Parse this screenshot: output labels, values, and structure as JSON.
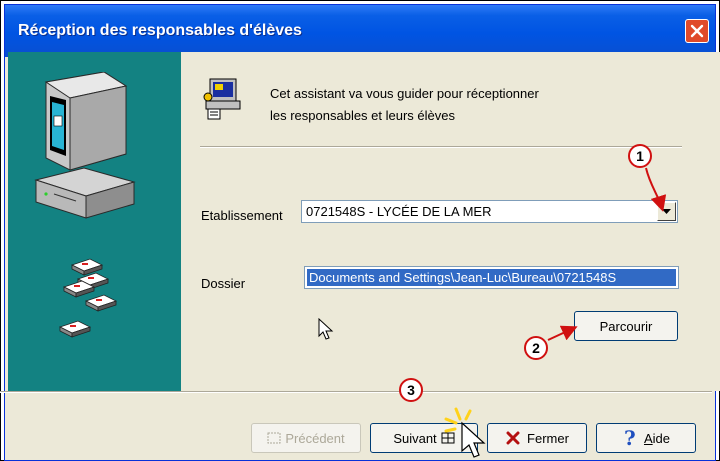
{
  "window": {
    "title": "Réception des responsables d'élèves"
  },
  "intro": {
    "line1": "Cet assistant va vous guider pour réceptionner",
    "line2": "les responsables et leurs élèves"
  },
  "fields": {
    "etablissement_label": "Etablissement",
    "etablissement_value": "0721548S - LYCÉE DE LA MER",
    "dossier_label": "Dossier",
    "dossier_value": "Documents and Settings\\Jean-Luc\\Bureau\\0721548S"
  },
  "buttons": {
    "parcourir": "Parcourir",
    "precedent": "Précédent",
    "suivant": "Suivant",
    "fermer": "Fermer",
    "aide_accel": "A",
    "aide_rest": "ide"
  },
  "callouts": {
    "one": "1",
    "two": "2",
    "three": "3"
  },
  "colors": {
    "titlebar": "#0054e3",
    "panel": "#138282",
    "selection": "#316ac5",
    "callout_arrow": "#d01010"
  },
  "icons": [
    "computer-icon",
    "floppy-disk-icon",
    "wizard-icon",
    "close-icon",
    "dropdown-arrow-icon",
    "cursor-icon",
    "help-icon",
    "x-icon"
  ]
}
